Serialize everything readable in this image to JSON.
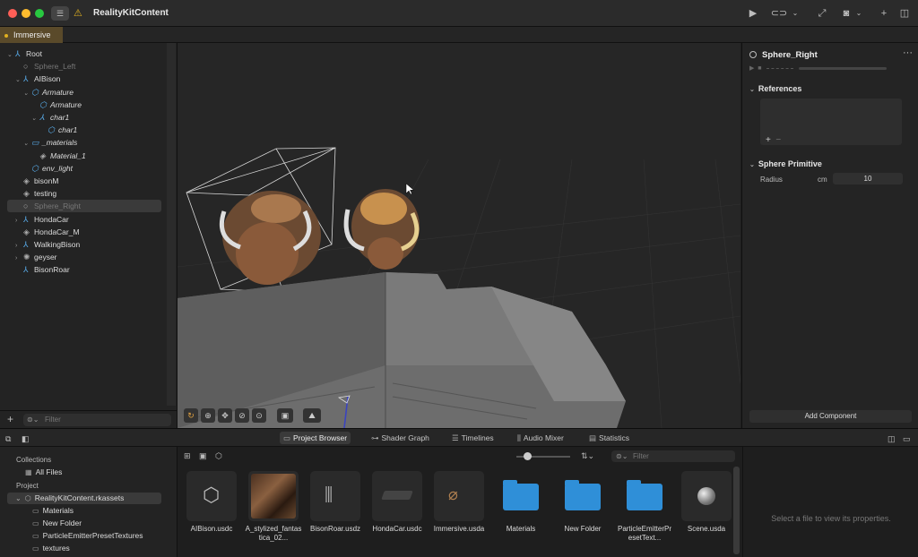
{
  "app": {
    "title": "RealityKitContent",
    "active_tab": "Immersive"
  },
  "scene_tree": {
    "rows": [
      {
        "label": "Root",
        "indent": 0,
        "chev": "⌄",
        "icon": "⅄",
        "style": "normal"
      },
      {
        "label": "Sphere_Left",
        "indent": 1,
        "chev": "",
        "icon": "○",
        "style": "dim"
      },
      {
        "label": "AIBison",
        "indent": 1,
        "chev": "⌄",
        "icon": "⅄",
        "style": "normal"
      },
      {
        "label": "Armature",
        "indent": 2,
        "chev": "⌄",
        "icon": "⬡",
        "style": "italic"
      },
      {
        "label": "Armature",
        "indent": 3,
        "chev": "",
        "icon": "⬡",
        "style": "italic"
      },
      {
        "label": "char1",
        "indent": 3,
        "chev": "⌄",
        "icon": "⅄",
        "style": "italic"
      },
      {
        "label": "char1",
        "indent": 4,
        "chev": "",
        "icon": "⬡",
        "style": "italic"
      },
      {
        "label": "_materials",
        "indent": 2,
        "chev": "⌄",
        "icon": "▭",
        "style": "italic"
      },
      {
        "label": "Material_1",
        "indent": 3,
        "chev": "",
        "icon": "◈",
        "style": "italic"
      },
      {
        "label": "env_light",
        "indent": 2,
        "chev": "",
        "icon": "⬡",
        "style": "italic"
      },
      {
        "label": "bisonM",
        "indent": 1,
        "chev": "",
        "icon": "◈",
        "style": "normal"
      },
      {
        "label": "testing",
        "indent": 1,
        "chev": "",
        "icon": "◈",
        "style": "normal"
      },
      {
        "label": "Sphere_Right",
        "indent": 1,
        "chev": "",
        "icon": "○",
        "style": "dim"
      },
      {
        "label": "HondaCar",
        "indent": 1,
        "chev": "›",
        "icon": "⅄",
        "style": "normal"
      },
      {
        "label": "HondaCar_M",
        "indent": 1,
        "chev": "",
        "icon": "◈",
        "style": "normal"
      },
      {
        "label": "WalkingBison",
        "indent": 1,
        "chev": "›",
        "icon": "⅄",
        "style": "normal"
      },
      {
        "label": "geyser",
        "indent": 1,
        "chev": "›",
        "icon": "✺",
        "style": "normal"
      },
      {
        "label": "BisonRoar",
        "indent": 1,
        "chev": "",
        "icon": "⅄",
        "style": "normal"
      }
    ],
    "filter_placeholder": "Filter"
  },
  "inspector": {
    "title": "Sphere_Right",
    "references_label": "References",
    "sphere_primitive_label": "Sphere Primitive",
    "radius_label": "Radius",
    "radius_unit": "cm",
    "radius_value": "10",
    "add_component_label": "Add Component"
  },
  "bottom_tabs": [
    "Project Browser",
    "Shader Graph",
    "Timelines",
    "Audio Mixer",
    "Statistics"
  ],
  "collections": {
    "collections_head": "Collections",
    "all_files": "All Files",
    "project_head": "Project",
    "project_name": "RealityKitContent.rkassets",
    "folders": [
      "Materials",
      "New Folder",
      "ParticleEmitterPresetTextures",
      "textures"
    ]
  },
  "browser": {
    "filter_placeholder": "Filter",
    "assets": [
      {
        "name": "AIBison.usdc",
        "kind": "cube"
      },
      {
        "name": "A_stylized_fantastica_02...",
        "kind": "photo"
      },
      {
        "name": "BisonRoar.usdz",
        "kind": "audio"
      },
      {
        "name": "HondaCar.usdc",
        "kind": "car"
      },
      {
        "name": "Immersive.usda",
        "kind": "scene"
      },
      {
        "name": "Materials",
        "kind": "folder"
      },
      {
        "name": "New Folder",
        "kind": "folder"
      },
      {
        "name": "ParticleEmitterPresetText...",
        "kind": "folder"
      },
      {
        "name": "Scene.usda",
        "kind": "sphere"
      }
    ],
    "empty_props": "Select a file to view its properties."
  }
}
